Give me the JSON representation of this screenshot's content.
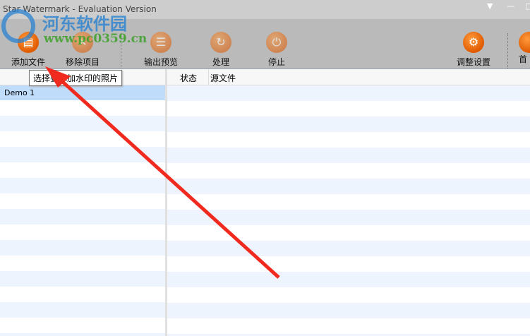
{
  "window": {
    "title": "Star Watermark - Evaluation Version"
  },
  "toolbar": {
    "items": [
      {
        "label": "添加文件",
        "icon": "add-file-icon"
      },
      {
        "label": "移除项目",
        "icon": "remove-icon"
      },
      {
        "label": "输出预览",
        "icon": "preview-icon"
      },
      {
        "label": "处理",
        "icon": "process-icon"
      },
      {
        "label": "停止",
        "icon": "stop-icon"
      },
      {
        "label": "调整设置",
        "icon": "settings-icon"
      },
      {
        "label": "首",
        "icon": "home-icon"
      }
    ]
  },
  "tooltip": "选择要添加水印的照片",
  "left_panel": {
    "items": [
      "Demo 1"
    ]
  },
  "right_panel": {
    "columns": [
      "状态",
      "源文件"
    ]
  },
  "watermark": {
    "line1": "河东软件园",
    "line2": "www.pc0359.cn"
  },
  "colors": {
    "accent": "#e05a00",
    "arrow": "#f02a1e"
  }
}
